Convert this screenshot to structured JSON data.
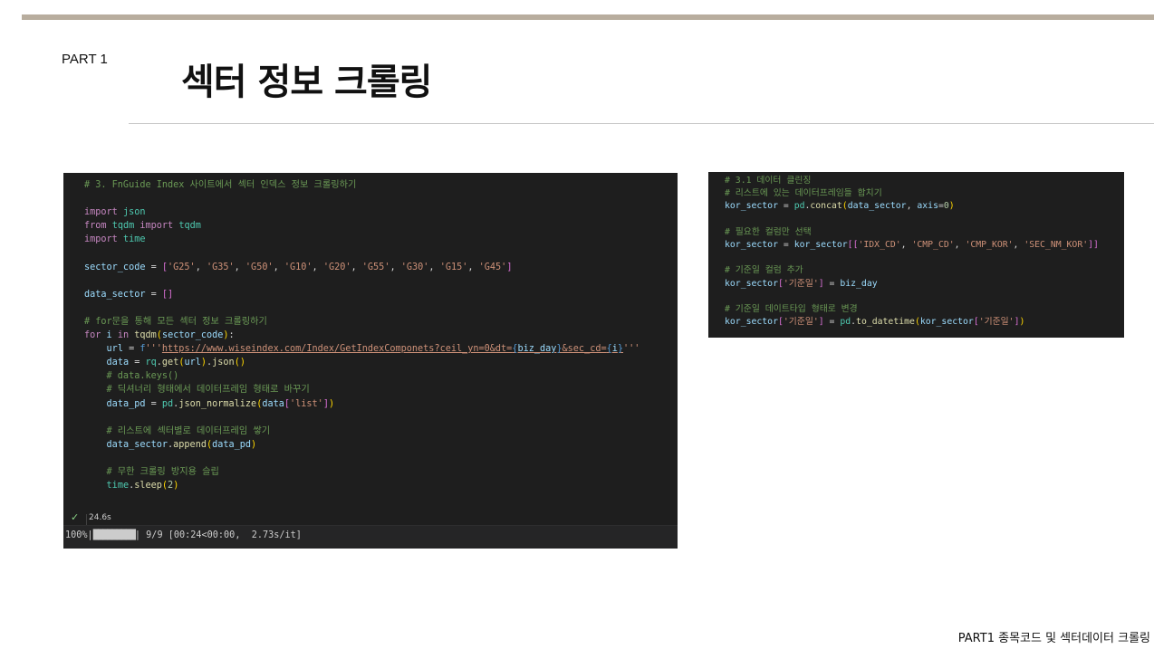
{
  "slide": {
    "part_label": "PART 1",
    "title": "섹터 정보 크롤링",
    "footer": "PART1 종목코드 및 섹터데이터 크롤링"
  },
  "cell_a": {
    "lines": [
      "# 3. FnGuide Index 사이트에서 섹터 인덱스 정보 크롤링하기",
      "",
      "import json",
      "from tqdm import tqdm",
      "import time",
      "",
      "sector_code = ['G25', 'G35', 'G50', 'G10', 'G20', 'G55', 'G30', 'G15', 'G45']",
      "",
      "data_sector = []",
      "",
      "# for문을 통해 모든 섹터 정보 크롤링하기",
      "for i in tqdm(sector_code):",
      "    url = f'''https://www.wiseindex.com/Index/GetIndexComponets?ceil_yn=0&dt={biz_day}&sec_cd={i}'''",
      "    data = rq.get(url).json()",
      "    # data.keys()",
      "    # 딕셔너리 형태에서 데이터프레임 형태로 바꾸기",
      "    data_pd = pd.json_normalize(data['list'])",
      "",
      "    # 리스트에 섹터별로 데이터프레임 쌓기",
      "    data_sector.append(data_pd)",
      "",
      "    # 무한 크롤링 방지용 슬립",
      "    time.sleep(2)"
    ],
    "status_icon": "check-icon",
    "elapsed": "24.6s",
    "progress": {
      "percent_label": "100%",
      "fraction": 1.0,
      "bar": "█████████",
      "count": "9/9",
      "timing": "[00:24<00:00,  2.73s/it]"
    }
  },
  "cell_b": {
    "lines": [
      "# 3.1 데이터 클린징",
      "# 리스트에 있는 데이터프레임들 합치기",
      "kor_sector = pd.concat(data_sector, axis=0)",
      "",
      "# 필요한 컬럼만 선택",
      "kor_sector = kor_sector[['IDX_CD', 'CMP_CD', 'CMP_KOR', 'SEC_NM_KOR']]",
      "",
      "# 기준일 컬럼 추가",
      "kor_sector['기준일'] = biz_day",
      "",
      "# 기준일 데이트타입 형태로 변경",
      "kor_sector['기준일'] = pd.to_datetime(kor_sector['기준일'])"
    ]
  },
  "colors": {
    "top_bar": "#b8ad9e",
    "code_bg": "#1e1e1e",
    "comment": "#6a9955",
    "keyword": "#c586c0",
    "string": "#ce9178",
    "variable": "#9cdcfe",
    "function": "#dcdcaa",
    "success": "#89d185"
  }
}
